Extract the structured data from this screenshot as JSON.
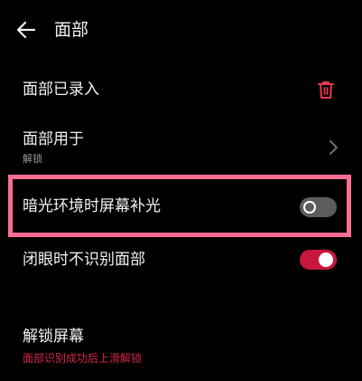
{
  "header": {
    "back_icon": "arrow-left-icon",
    "title": "面部"
  },
  "rows": {
    "face_enrolled": {
      "label": "面部已录入",
      "action_icon": "trash-icon",
      "action_color": "#e8364e"
    },
    "face_used_for": {
      "label": "面部用于",
      "sub": "解锁",
      "sub_color": "#9a9a9a",
      "icon": "chevron-right-icon"
    },
    "dark_fill_light": {
      "label": "暗光环境时屏幕补光",
      "toggle_on": false
    },
    "eyes_closed": {
      "label": "闭眼时不识别面部",
      "toggle_on": true
    },
    "unlock_screen": {
      "label": "解锁屏幕",
      "sub": "面部识别成功后上滑解锁",
      "sub_color": "#d8254a"
    }
  },
  "colors": {
    "background": "#000000",
    "accent": "#c8173e",
    "highlight": "#ff6e92"
  }
}
